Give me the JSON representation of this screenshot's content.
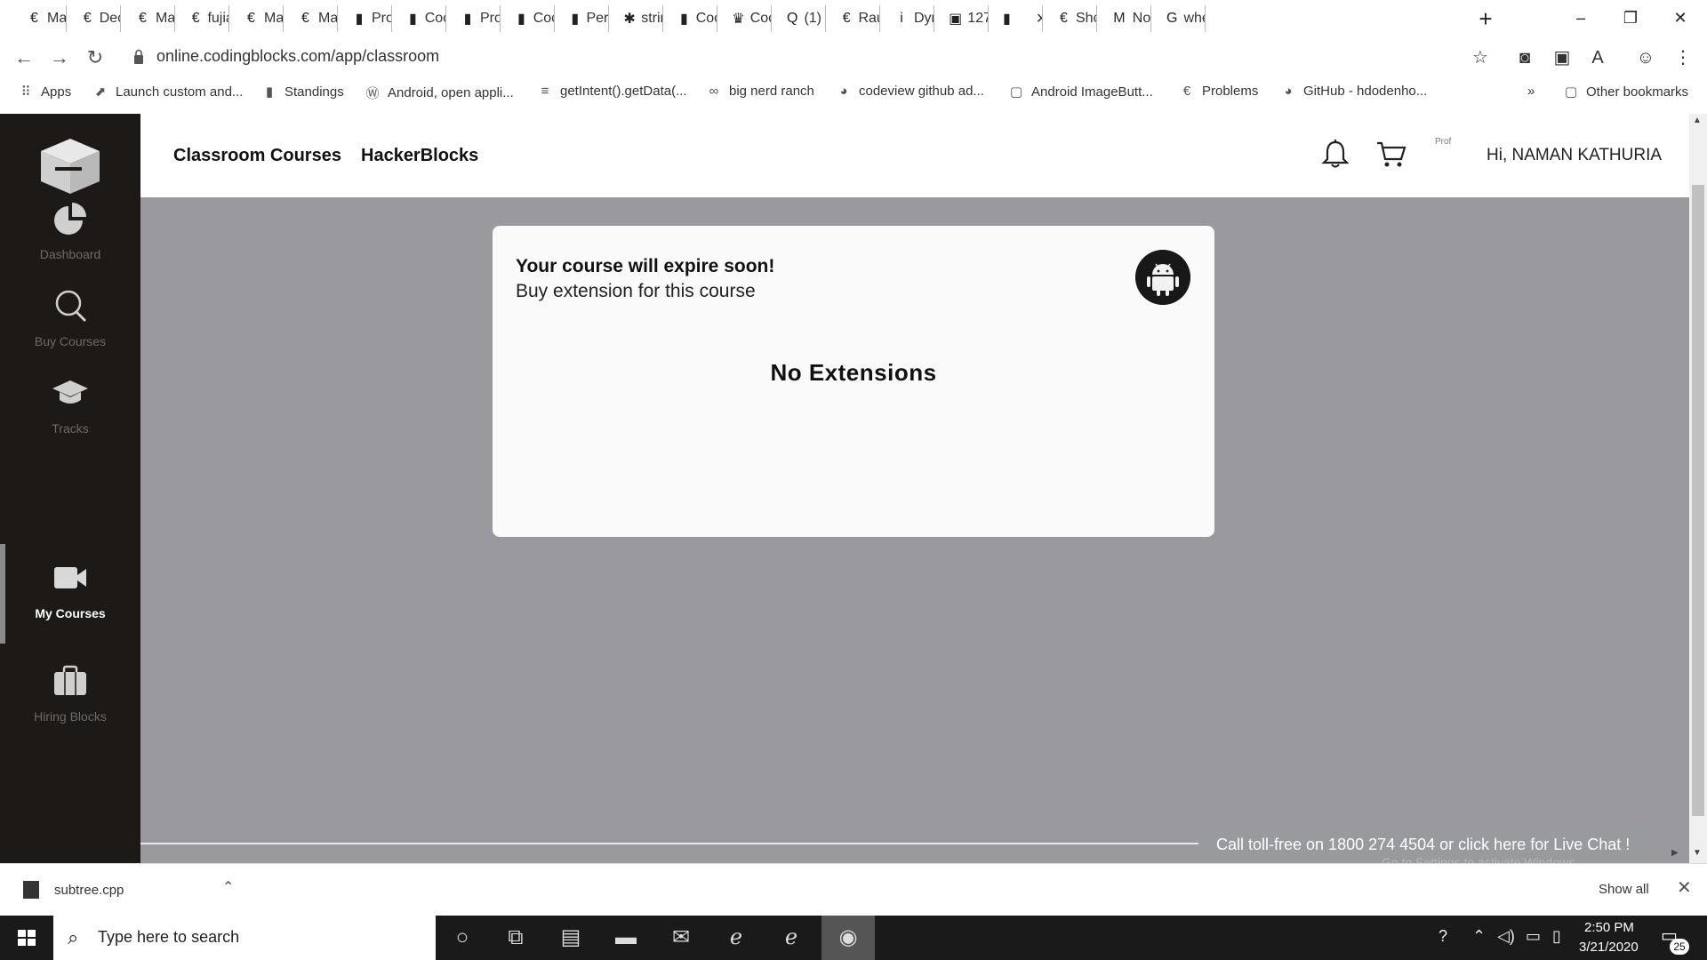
{
  "browser": {
    "tabs": [
      {
        "label": "Ma",
        "icon": "coding-blocks-icon"
      },
      {
        "label": "Dec",
        "icon": "coding-blocks-icon"
      },
      {
        "label": "Ma",
        "icon": "coding-blocks-icon"
      },
      {
        "label": "fujia",
        "icon": "coding-blocks-icon"
      },
      {
        "label": "Ma",
        "icon": "coding-blocks-icon"
      },
      {
        "label": "Ma",
        "icon": "coding-blocks-icon"
      },
      {
        "label": "Pro",
        "icon": "bar-chart-icon"
      },
      {
        "label": "Coc",
        "icon": "bar-chart-icon"
      },
      {
        "label": "Pro",
        "icon": "bar-chart-icon"
      },
      {
        "label": "Coc",
        "icon": "bar-chart-icon"
      },
      {
        "label": "Pers",
        "icon": "bar-chart-icon"
      },
      {
        "label": "strin",
        "icon": "bug-icon"
      },
      {
        "label": "Coc",
        "icon": "bar-chart-icon"
      },
      {
        "label": "Coc",
        "icon": "codechef-icon"
      },
      {
        "label": "(1) (",
        "icon": "quora-icon"
      },
      {
        "label": "Rau",
        "icon": "coding-blocks-icon"
      },
      {
        "label": "Dyr",
        "icon": "ib-icon"
      },
      {
        "label": "127",
        "icon": "leetcode-icon"
      },
      {
        "label": "",
        "icon": "active-tab-icon"
      },
      {
        "label": "Shc",
        "icon": "coding-blocks-icon"
      },
      {
        "label": "No",
        "icon": "gmail-icon"
      },
      {
        "label": "whe",
        "icon": "google-icon"
      }
    ],
    "url": "online.codingblocks.com/app/classroom",
    "bookmarks": [
      {
        "label": "Apps",
        "icon": "apps-grid-icon"
      },
      {
        "label": "Launch custom and...",
        "icon": "launch-icon"
      },
      {
        "label": "Standings",
        "icon": "bar-chart-icon"
      },
      {
        "label": "Android, open appli...",
        "icon": "wordpress-icon"
      },
      {
        "label": "getIntent().getData(...",
        "icon": "stack-icon"
      },
      {
        "label": "big nerd ranch",
        "icon": "link-icon"
      },
      {
        "label": "codeview github ad...",
        "icon": "github-icon"
      },
      {
        "label": "Android ImageButt...",
        "icon": "android-doc-icon"
      },
      {
        "label": "Problems",
        "icon": "coding-blocks-icon"
      },
      {
        "label": "GitHub - hdodenho...",
        "icon": "github-icon"
      }
    ],
    "bookmarks_overflow": "»",
    "other_bookmarks": "Other bookmarks"
  },
  "sidebar": {
    "items": [
      {
        "label": "Dashboard",
        "icon": "pie-chart-icon",
        "active": false
      },
      {
        "label": "Buy Courses",
        "icon": "search-icon",
        "active": false
      },
      {
        "label": "Tracks",
        "icon": "graduation-cap-icon",
        "active": false
      },
      {
        "label": "My Courses",
        "icon": "video-camera-icon",
        "active": true
      },
      {
        "label": "Hiring Blocks",
        "icon": "briefcase-icon",
        "active": false
      }
    ]
  },
  "topnav": {
    "links": [
      "Classroom Courses",
      "HackerBlocks"
    ],
    "avatar_alt": "Prof",
    "greeting": "Hi, NAMAN KATHURIA"
  },
  "card": {
    "title": "Your course will expire soon!",
    "subtitle": "Buy extension for this course",
    "empty_text": "No Extensions",
    "badge_icon": "android-icon"
  },
  "livechat": "Call toll-free on 1800 274 4504 or click here for Live Chat !",
  "activate_watermark": "Go to Settings to activate Windows",
  "download": {
    "filename": "subtree.cpp",
    "show_all": "Show all"
  },
  "taskbar": {
    "search_placeholder": "Type here to search",
    "time": "2:50 PM",
    "date": "3/21/2020",
    "notification_count": "25"
  },
  "colors": {
    "sidebar_bg": "#1c1917",
    "content_bg": "#99999e",
    "card_bg": "#fafafa",
    "taskbar_bg": "#1a1a1a"
  }
}
